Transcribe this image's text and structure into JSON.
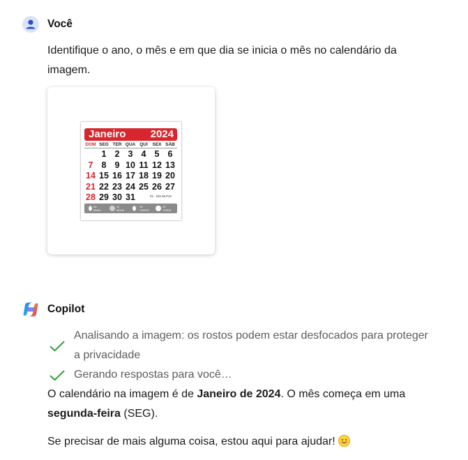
{
  "user": {
    "name": "Você",
    "message_lines": [
      "Identifique o ano, o mês e em que dia se inicia o mês no calendário da",
      "imagem."
    ]
  },
  "calendar_image": {
    "month": "Janeiro",
    "year": "2024",
    "weekdays": [
      "DOM",
      "SEG",
      "TER",
      "QUA",
      "QUI",
      "SEX",
      "SÁB"
    ],
    "weeks": [
      [
        "",
        "1",
        "2",
        "3",
        "4",
        "5",
        "6"
      ],
      [
        "7",
        "8",
        "9",
        "10",
        "11",
        "12",
        "13"
      ],
      [
        "14",
        "15",
        "16",
        "17",
        "18",
        "19",
        "20"
      ],
      [
        "21",
        "22",
        "23",
        "24",
        "25",
        "26",
        "27"
      ],
      [
        "28",
        "29",
        "30",
        "31",
        "",
        "",
        ""
      ]
    ],
    "note": "01 - Dia da Paz",
    "moon_phases": [
      {
        "day": "04",
        "label": "MING."
      },
      {
        "day": "11",
        "label": "NOVA"
      },
      {
        "day": "18",
        "label": "CRESC."
      },
      {
        "day": "25",
        "label": "CHEIA"
      }
    ],
    "accent_color": "#d7262d"
  },
  "copilot": {
    "name": "Copilot",
    "status_1_line1": "Analisando a imagem: os rostos podem estar desfocados para proteger",
    "status_1_line2": "a privacidade",
    "status_2": "Gerando respostas para você…",
    "answer_p1_a": "O calendário na imagem é de ",
    "answer_p1_b": "Janeiro de 2024",
    "answer_p1_c": ". O mês começa em uma",
    "answer_p1_d": "segunda-feira",
    "answer_p1_e": " (SEG).",
    "answer_p2": "Se precisar de mais alguma coisa, estou aqui para ajudar! ",
    "emoji_icon": "smiling-face-emoji",
    "check_color": "#2e9e3a"
  }
}
